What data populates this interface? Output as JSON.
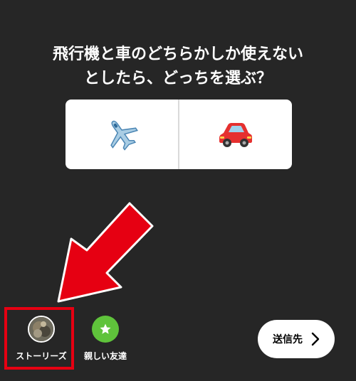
{
  "question": {
    "line1": "飛行機と車のどちらかしか使えない",
    "line2": "としたら、どっちを選ぶ？"
  },
  "poll": {
    "options": [
      {
        "icon": "airplane-emoji"
      },
      {
        "icon": "car-emoji"
      }
    ]
  },
  "share": {
    "stories_label": "ストーリーズ",
    "close_friends_label": "親しい友達"
  },
  "send": {
    "label": "送信先"
  },
  "colors": {
    "background": "#262626",
    "highlight": "#e60012",
    "close_friends_green": "#5fc33b"
  }
}
